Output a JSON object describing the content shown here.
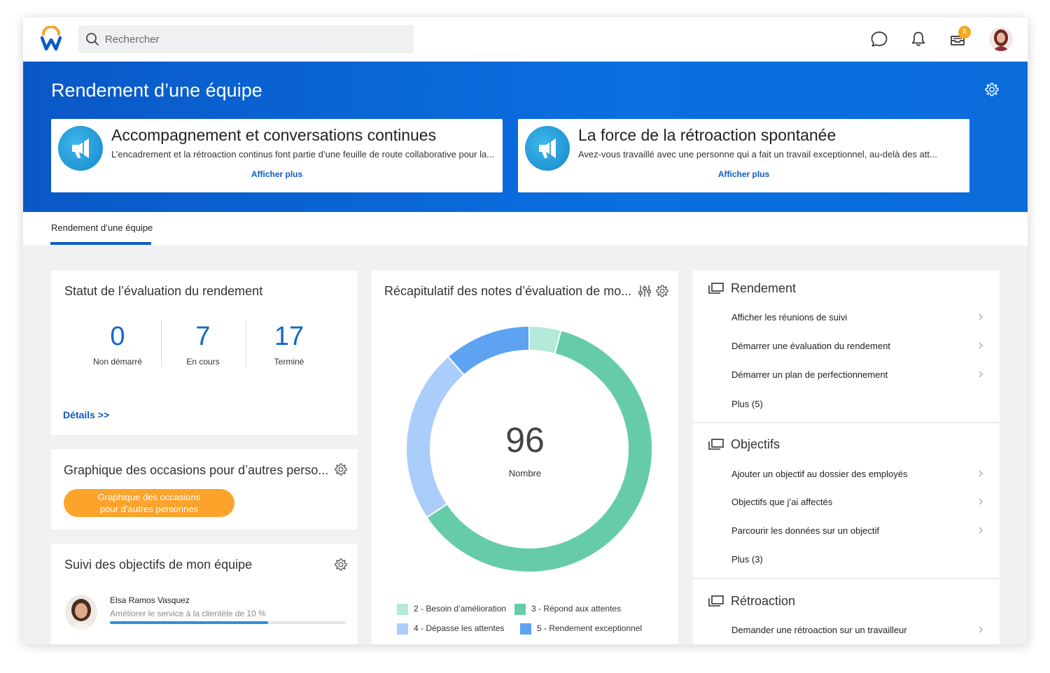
{
  "topbar": {
    "search_placeholder": "Rechercher",
    "notification_badge": "8"
  },
  "hero": {
    "title": "Rendement d’une équipe",
    "cards": [
      {
        "title": "Accompagnement et conversations continues",
        "desc": "L’encadrement et la rétroaction continus font partie d’une feuille de route collaborative pour la...",
        "link": "Afficher plus"
      },
      {
        "title": "La force de la rétroaction spontanée",
        "desc": "Avez-vous travaillé avec une personne qui a fait un travail exceptionnel, au-delà des att...",
        "link": "Afficher plus"
      }
    ]
  },
  "tabs": [
    {
      "label": "Rendement d’une équipe"
    }
  ],
  "status_card": {
    "title": "Statut de l’évaluation du rendement",
    "stats": [
      {
        "value": "0",
        "label": "Non démarré"
      },
      {
        "value": "7",
        "label": "En cours"
      },
      {
        "value": "17",
        "label": "Terminé"
      }
    ],
    "details_link": "Détails >>"
  },
  "occasions_card": {
    "title": "Graphique des occasions pour d’autres perso...",
    "button_line1": "Graphique des occasions",
    "button_line2": "pour d’autres personnes"
  },
  "goals_card": {
    "title": "Suivi des objectifs de mon équipe",
    "person_name": "Elsa Ramos Vasquez",
    "goal": "Améliorer le service à la clientèle de 10 %",
    "progress": 0.67
  },
  "recap_card": {
    "title": "Récapitulatif des notes d’évaluation de mo...",
    "center_value": "96",
    "center_label": "Nombre"
  },
  "chart_data": {
    "type": "pie",
    "donut": true,
    "total": 96,
    "series": [
      {
        "name": "2 - Besoin d’amélioration",
        "value": 4,
        "color": "#b3ead9"
      },
      {
        "name": "3 - Répond aux attentes",
        "value": 59,
        "color": "#66cba9"
      },
      {
        "name": "4 - Dépasse les attentes",
        "value": 22,
        "color": "#abcdfb"
      },
      {
        "name": "5 - Rendement exceptionnel",
        "value": 11,
        "color": "#5ea2f2"
      }
    ],
    "legend_position": "bottom"
  },
  "menu": {
    "sections": [
      {
        "title": "Rendement",
        "items": [
          "Afficher les réunions de suivi",
          "Démarrer une évaluation du rendement",
          "Démarrer un plan de perfectionnement"
        ],
        "more": "Plus (5)"
      },
      {
        "title": "Objectifs",
        "items": [
          "Ajouter un objectif au dossier des employés",
          "Objectifs que j’ai affectés",
          "Parcourir les données sur un objectif"
        ],
        "more": "Plus (3)"
      },
      {
        "title": "Rétroaction",
        "items": [
          "Demander une rétroaction sur un travailleur"
        ]
      }
    ]
  },
  "colors": {
    "brand_blue": "#0a64d6",
    "link_blue": "#0b5cc3",
    "accent_orange": "#fca32c"
  }
}
